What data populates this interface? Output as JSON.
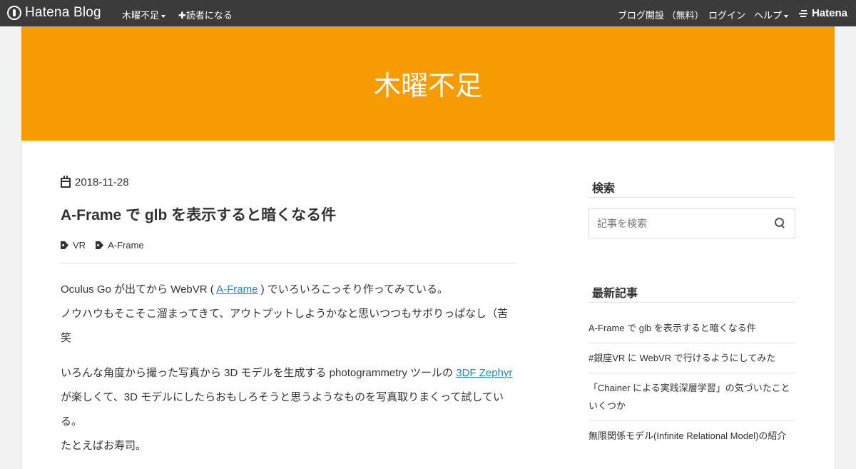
{
  "topbar": {
    "logo_text": "Hatena Blog",
    "blog_menu": "木曜不足",
    "subscribe": "✚読者になる",
    "open_blog": "ブログ開設 （無料）",
    "login": "ログイン",
    "help": "ヘルプ",
    "hatena": "Hatena"
  },
  "header": {
    "title": "木曜不足"
  },
  "entry": {
    "date": "2018-11-28",
    "title": "A-Frame で glb を表示すると暗くなる件",
    "tags": [
      "VR",
      "A-Frame"
    ],
    "p1_before": "Oculus Go が出てから WebVR ( ",
    "p1_link": "A-Frame",
    "p1_after": " ) でいろいろこっそり作ってみている。",
    "p2": "ノウハウもそこそこ溜まってきて、アウトプットしようかなと思いつつもサボりっぱなし（苦笑",
    "p3_before": "いろんな角度から撮った写真から 3D モデルを生成する photogrammetry ツールの ",
    "p3_link": "3DF Zephyr",
    "p3_after": " が楽しくて、3D モデルにしたらおもしろそうと思うようなものを写真取りまくって試している。",
    "p4": "たとえばお寿司。"
  },
  "sidebar": {
    "search_heading": "検索",
    "search_placeholder": "記事を検索",
    "recent_heading": "最新記事",
    "recent": [
      "A-Frame で glb を表示すると暗くなる件",
      "#銀座VR に WebVR で行けるようにしてみた",
      "「Chainer による実践深層学習」の気づいたこといくつか",
      "無限関係モデル(Infinite Relational Model)の紹介"
    ]
  },
  "colors": {
    "topbar": "#3b3b3b",
    "header": "#f69b00",
    "link": "#2089c7"
  }
}
